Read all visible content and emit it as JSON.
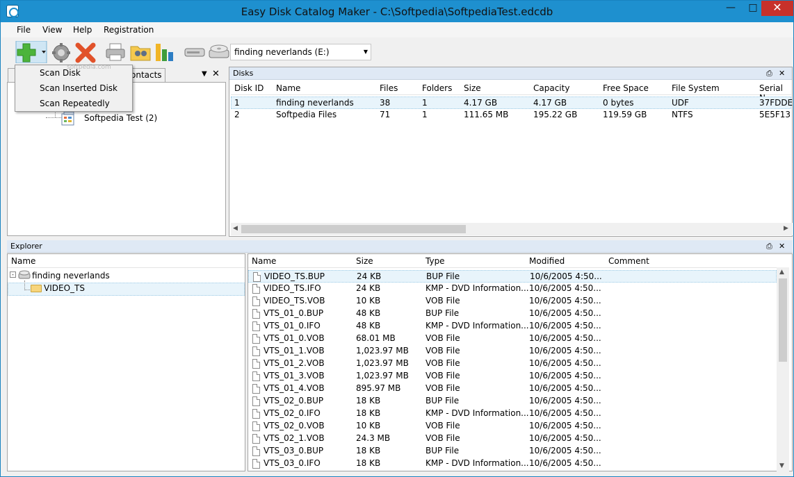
{
  "window": {
    "title": "Easy Disk Catalog Maker - C:\\Softpedia\\SoftpediaTest.edcdb"
  },
  "menu": [
    "File",
    "View",
    "Help",
    "Registration"
  ],
  "toolbar": {
    "drive_select_value": "finding neverlands (E:)",
    "icons": [
      "add-icon",
      "scan-settings-icon",
      "delete-icon",
      "print-icon",
      "find-folder-icon",
      "statistics-icon",
      "drive-icon",
      "cd-drive-icon"
    ]
  },
  "dropdown": {
    "items": [
      "Scan Disk",
      "Scan Inserted Disk",
      "Scan Repeatedly"
    ]
  },
  "left_panel": {
    "tab_label": "ontacts",
    "tree_item": "Softpedia Test (2)"
  },
  "disks_panel": {
    "title": "Disks",
    "columns": [
      "Disk ID",
      "Name",
      "Files",
      "Folders",
      "Size",
      "Capacity",
      "Free Space",
      "File System",
      "Serial N"
    ],
    "rows": [
      [
        "1",
        "finding neverlands",
        "38",
        "1",
        "4.17 GB",
        "4.17 GB",
        "0 bytes",
        "UDF",
        "37FDDE"
      ],
      [
        "2",
        "Softpedia Files",
        "71",
        "1",
        "111.65 MB",
        "195.22 GB",
        "119.59 GB",
        "NTFS",
        "5E5F13"
      ]
    ]
  },
  "explorer_panel": {
    "title": "Explorer",
    "tree_header": "Name",
    "tree": [
      "finding neverlands",
      "VIDEO_TS"
    ],
    "columns": [
      "Name",
      "Size",
      "Type",
      "Modified",
      "Comment"
    ],
    "rows": [
      [
        "VIDEO_TS.BUP",
        "24 KB",
        "BUP File",
        "10/6/2005 4:50..."
      ],
      [
        "VIDEO_TS.IFO",
        "24 KB",
        "KMP - DVD Information...",
        "10/6/2005 4:50..."
      ],
      [
        "VIDEO_TS.VOB",
        "10 KB",
        "VOB File",
        "10/6/2005 4:50..."
      ],
      [
        "VTS_01_0.BUP",
        "48 KB",
        "BUP File",
        "10/6/2005 4:50..."
      ],
      [
        "VTS_01_0.IFO",
        "48 KB",
        "KMP - DVD Information...",
        "10/6/2005 4:50..."
      ],
      [
        "VTS_01_0.VOB",
        "68.01 MB",
        "VOB File",
        "10/6/2005 4:50..."
      ],
      [
        "VTS_01_1.VOB",
        "1,023.97 MB",
        "VOB File",
        "10/6/2005 4:50..."
      ],
      [
        "VTS_01_2.VOB",
        "1,023.97 MB",
        "VOB File",
        "10/6/2005 4:50..."
      ],
      [
        "VTS_01_3.VOB",
        "1,023.97 MB",
        "VOB File",
        "10/6/2005 4:50..."
      ],
      [
        "VTS_01_4.VOB",
        "895.97 MB",
        "VOB File",
        "10/6/2005 4:50..."
      ],
      [
        "VTS_02_0.BUP",
        "18 KB",
        "BUP File",
        "10/6/2005 4:50..."
      ],
      [
        "VTS_02_0.IFO",
        "18 KB",
        "KMP - DVD Information...",
        "10/6/2005 4:50..."
      ],
      [
        "VTS_02_0.VOB",
        "10 KB",
        "VOB File",
        "10/6/2005 4:50..."
      ],
      [
        "VTS_02_1.VOB",
        "24.3 MB",
        "VOB File",
        "10/6/2005 4:50..."
      ],
      [
        "VTS_03_0.BUP",
        "18 KB",
        "BUP File",
        "10/6/2005 4:50..."
      ],
      [
        "VTS_03_0.IFO",
        "18 KB",
        "KMP - DVD Information...",
        "10/6/2005 4:50..."
      ]
    ]
  },
  "watermark": "softpedia.com",
  "colors": {
    "titlebar": "#1e90cf",
    "close": "#c7312b",
    "panel_header": "#dfe9f5",
    "selection": "#e8f4fb"
  }
}
